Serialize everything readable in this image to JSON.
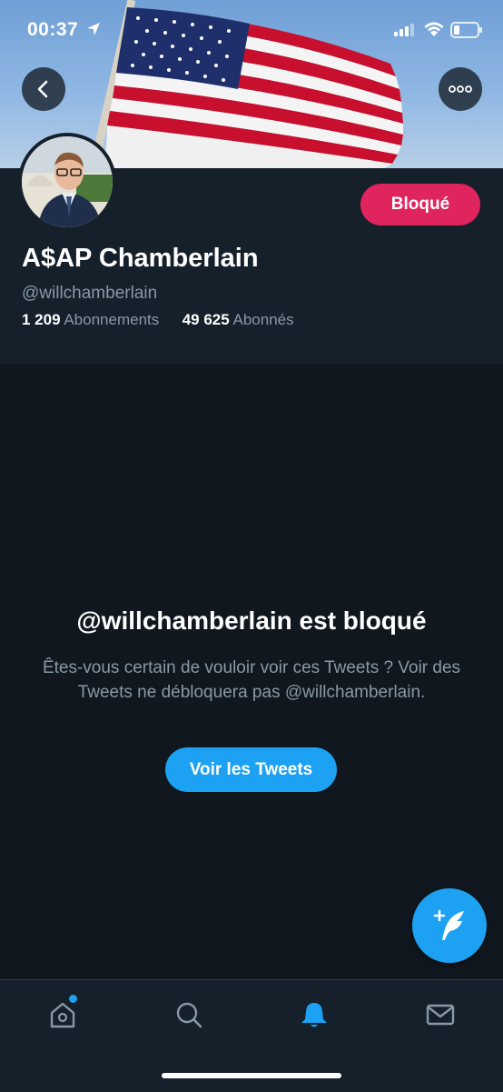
{
  "status_bar": {
    "time": "00:37"
  },
  "profile": {
    "blocked_label": "Bloqué",
    "display_name": "A$AP Chamberlain",
    "handle": "@willchamberlain",
    "following_count": "1 209",
    "following_label": "Abonnements",
    "followers_count": "49 625",
    "followers_label": "Abonnés"
  },
  "blocked_notice": {
    "title": "@willchamberlain est bloqué",
    "description": "Êtes-vous certain de vouloir voir ces Tweets ? Voir des Tweets ne débloquera pas @willchamberlain.",
    "view_button": "Voir les Tweets"
  },
  "icons": {
    "back": "chevron-left-icon",
    "more": "more-horizontal-icon",
    "compose": "compose-feather-icon",
    "home": "home-icon",
    "search": "search-icon",
    "notifications": "bell-icon",
    "messages": "mail-icon"
  },
  "colors": {
    "accent": "#1da1f2",
    "blocked": "#e0245e",
    "background": "#10171e",
    "panel": "#15202b",
    "secondary_text": "#8899a6"
  }
}
